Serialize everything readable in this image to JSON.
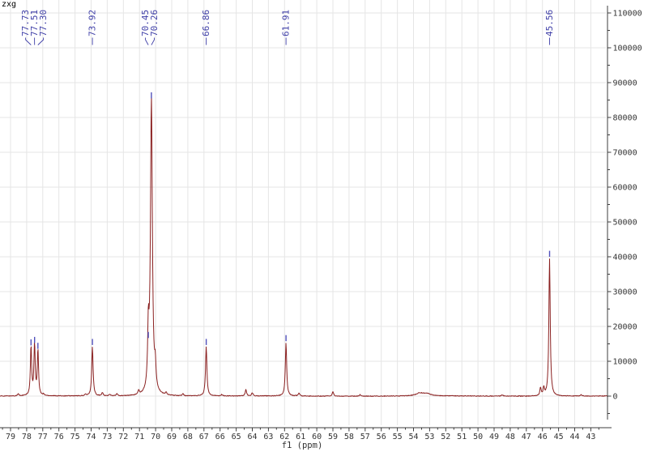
{
  "annotation": "zxg",
  "chart_data": {
    "type": "line",
    "title": "zxg",
    "xlabel": "f1 (ppm)",
    "x_axis": {
      "min": 42.0,
      "max": 79.65,
      "reversed": true,
      "major_tick_step": 1,
      "minor_tick_step": 0.5,
      "tick_labels": [
        79,
        78,
        77,
        76,
        75,
        74,
        73,
        72,
        71,
        70,
        69,
        68,
        67,
        66,
        65,
        64,
        63,
        62,
        61,
        60,
        59,
        58,
        57,
        56,
        55,
        54,
        53,
        52,
        51,
        50,
        49,
        48,
        47,
        46,
        45,
        44,
        43
      ]
    },
    "y_axis": {
      "min": -7000,
      "max": 112000,
      "major_tick_step": 10000,
      "minor_tick_step": 5000,
      "tick_labels": [
        0,
        10000,
        20000,
        30000,
        40000,
        50000,
        60000,
        70000,
        80000,
        90000,
        100000,
        110000
      ]
    },
    "grid": "on",
    "colors": {
      "trace": "#8a2020",
      "peak_label": "#4040a8",
      "peak_marker": "#5050bb",
      "axis": "#3c3c3c",
      "tick_text": "#333333",
      "grid_line": "#e5e5e5"
    },
    "peaks": [
      {
        "ppm": 78.52,
        "intensity": 600,
        "width": 0.04,
        "label": null
      },
      {
        "ppm": 77.73,
        "intensity": 14100,
        "width": 0.045,
        "label": "77.73"
      },
      {
        "ppm": 77.51,
        "intensity": 14800,
        "width": 0.045,
        "label": "77.51"
      },
      {
        "ppm": 77.3,
        "intensity": 13100,
        "width": 0.045,
        "label": "77.30"
      },
      {
        "ppm": 76.95,
        "intensity": 400,
        "width": 0.04,
        "label": null
      },
      {
        "ppm": 74.35,
        "intensity": 450,
        "width": 0.04,
        "label": null
      },
      {
        "ppm": 73.92,
        "intensity": 14200,
        "width": 0.05,
        "label": "73.92"
      },
      {
        "ppm": 73.3,
        "intensity": 900,
        "width": 0.05,
        "label": null
      },
      {
        "ppm": 72.85,
        "intensity": 500,
        "width": 0.05,
        "label": null
      },
      {
        "ppm": 72.4,
        "intensity": 600,
        "width": 0.05,
        "label": null
      },
      {
        "ppm": 71.05,
        "intensity": 1100,
        "width": 0.05,
        "label": null
      },
      {
        "ppm": 70.45,
        "intensity": 16200,
        "width": 0.05,
        "label": "70.45"
      },
      {
        "ppm": 70.26,
        "intensity": 85000,
        "width": 0.07,
        "label": "70.26"
      },
      {
        "ppm": 70.02,
        "intensity": 6200,
        "width": 0.05,
        "label": null
      },
      {
        "ppm": 69.35,
        "intensity": 700,
        "width": 0.05,
        "label": null
      },
      {
        "ppm": 68.3,
        "intensity": 550,
        "width": 0.05,
        "label": null
      },
      {
        "ppm": 66.86,
        "intensity": 14200,
        "width": 0.05,
        "label": "66.86"
      },
      {
        "ppm": 65.9,
        "intensity": 350,
        "width": 0.05,
        "label": null
      },
      {
        "ppm": 64.4,
        "intensity": 1800,
        "width": 0.05,
        "label": null
      },
      {
        "ppm": 64.0,
        "intensity": 900,
        "width": 0.05,
        "label": null
      },
      {
        "ppm": 61.91,
        "intensity": 15300,
        "width": 0.05,
        "label": "61.91"
      },
      {
        "ppm": 61.1,
        "intensity": 900,
        "width": 0.05,
        "label": null
      },
      {
        "ppm": 59.0,
        "intensity": 1300,
        "width": 0.05,
        "label": null
      },
      {
        "ppm": 57.3,
        "intensity": 450,
        "width": 0.05,
        "label": null
      },
      {
        "ppm": 53.6,
        "intensity": 800,
        "width": 0.3,
        "label": null
      },
      {
        "ppm": 53.15,
        "intensity": 550,
        "width": 0.25,
        "label": null
      },
      {
        "ppm": 48.5,
        "intensity": 350,
        "width": 0.06,
        "label": null
      },
      {
        "ppm": 46.12,
        "intensity": 2300,
        "width": 0.045,
        "label": null
      },
      {
        "ppm": 45.92,
        "intensity": 2300,
        "width": 0.045,
        "label": null
      },
      {
        "ppm": 45.56,
        "intensity": 39500,
        "width": 0.05,
        "label": "45.56"
      },
      {
        "ppm": 43.6,
        "intensity": 400,
        "width": 0.06,
        "label": null
      }
    ]
  }
}
